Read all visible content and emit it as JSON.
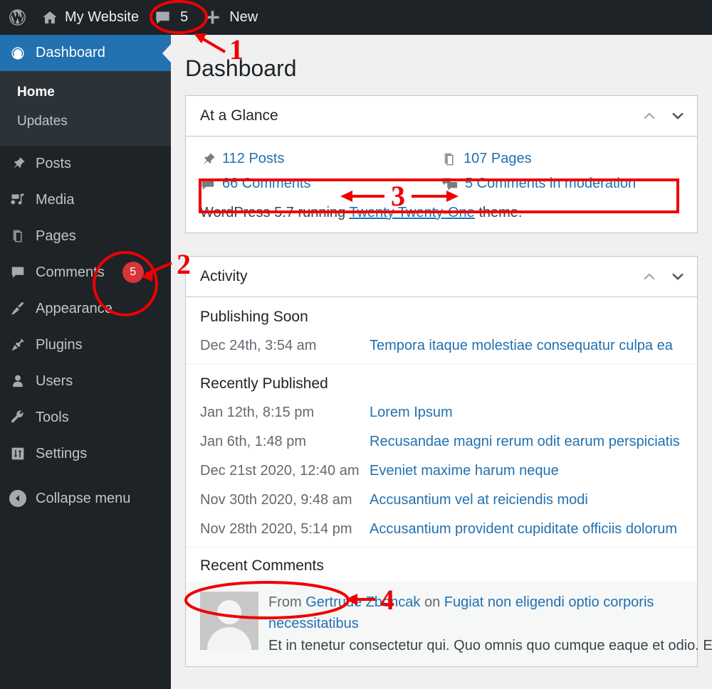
{
  "adminbar": {
    "logo_icon": "wordpress-logo-icon",
    "site_name": "My Website",
    "home_icon": "home-icon",
    "comments_icon": "comment-bubble-icon",
    "comments_count": "5",
    "new_icon": "plus-icon",
    "new_label": "New"
  },
  "sidebar": {
    "items": [
      {
        "label": "Dashboard",
        "icon": "dashboard-gauge-icon",
        "current": true
      },
      {
        "label": "Posts",
        "icon": "pin-icon",
        "current": false
      },
      {
        "label": "Media",
        "icon": "media-icon",
        "current": false
      },
      {
        "label": "Pages",
        "icon": "pages-icon",
        "current": false
      },
      {
        "label": "Comments",
        "icon": "comment-bubble-icon",
        "current": false,
        "badge": "5"
      },
      {
        "label": "Appearance",
        "icon": "paintbrush-icon",
        "current": false
      },
      {
        "label": "Plugins",
        "icon": "plug-icon",
        "current": false
      },
      {
        "label": "Users",
        "icon": "user-icon",
        "current": false
      },
      {
        "label": "Tools",
        "icon": "wrench-icon",
        "current": false
      },
      {
        "label": "Settings",
        "icon": "settings-sliders-icon",
        "current": false
      }
    ],
    "submenu": [
      {
        "label": "Home",
        "current": true
      },
      {
        "label": "Updates",
        "current": false
      }
    ],
    "collapse": {
      "label": "Collapse menu",
      "icon": "collapse-arrow-icon"
    }
  },
  "page": {
    "title": "Dashboard"
  },
  "at_a_glance": {
    "title": "At a Glance",
    "order_icon": "chevron-up-icon",
    "toggle_icon": "chevron-down-icon",
    "items": [
      {
        "label": "112 Posts",
        "icon": "pin-icon"
      },
      {
        "label": "107 Pages",
        "icon": "pages-icon"
      },
      {
        "label": "66 Comments",
        "icon": "comment-bubble-icon"
      },
      {
        "label": "5 Comments in moderation",
        "icon": "double-comment-bubble-icon"
      }
    ],
    "version_prefix": "WordPress 5.7 running ",
    "theme_link": "Twenty Twenty-One",
    "version_suffix": " theme."
  },
  "activity": {
    "title": "Activity",
    "order_icon": "chevron-up-icon",
    "toggle_icon": "chevron-down-icon",
    "publishing_soon": {
      "heading": "Publishing Soon",
      "rows": [
        {
          "date": "Dec 24th, 3:54 am",
          "title": "Tempora itaque molestiae consequatur culpa ea"
        }
      ]
    },
    "recently_published": {
      "heading": "Recently Published",
      "rows": [
        {
          "date": "Jan 12th, 8:15 pm",
          "title": "Lorem Ipsum"
        },
        {
          "date": "Jan 6th, 1:48 pm",
          "title": "Recusandae magni rerum odit earum perspiciatis"
        },
        {
          "date": "Dec 21st 2020, 12:40 am",
          "title": "Eveniet maxime harum neque"
        },
        {
          "date": "Nov 30th 2020, 9:48 am",
          "title": "Accusantium vel at reiciendis modi"
        },
        {
          "date": "Nov 28th 2020, 5:14 pm",
          "title": "Accusantium provident cupiditate officiis dolorum"
        }
      ]
    },
    "recent_comments": {
      "heading": "Recent Comments",
      "comments": [
        {
          "from_label": "From ",
          "author": "Gertrude Zboncak",
          "on_label": " on ",
          "post": "Fugiat non eligendi optio corporis necessitatibus",
          "excerpt": "Et in tenetur consectetur qui. Quo omnis quo cumque eaque et odio. Es",
          "avatar": "default-user-avatar"
        }
      ]
    }
  },
  "annotations": {
    "accent_color": "#ee0000",
    "markers": [
      {
        "number": "1",
        "shape": "ellipse",
        "target": "adminbar-comments-count"
      },
      {
        "number": "2",
        "shape": "circle",
        "target": "sidebar-comments-badge"
      },
      {
        "number": "3",
        "shape": "rectangle",
        "target": "glance-comments-row"
      },
      {
        "number": "4",
        "shape": "ellipse",
        "target": "recent-comments-heading"
      }
    ]
  }
}
